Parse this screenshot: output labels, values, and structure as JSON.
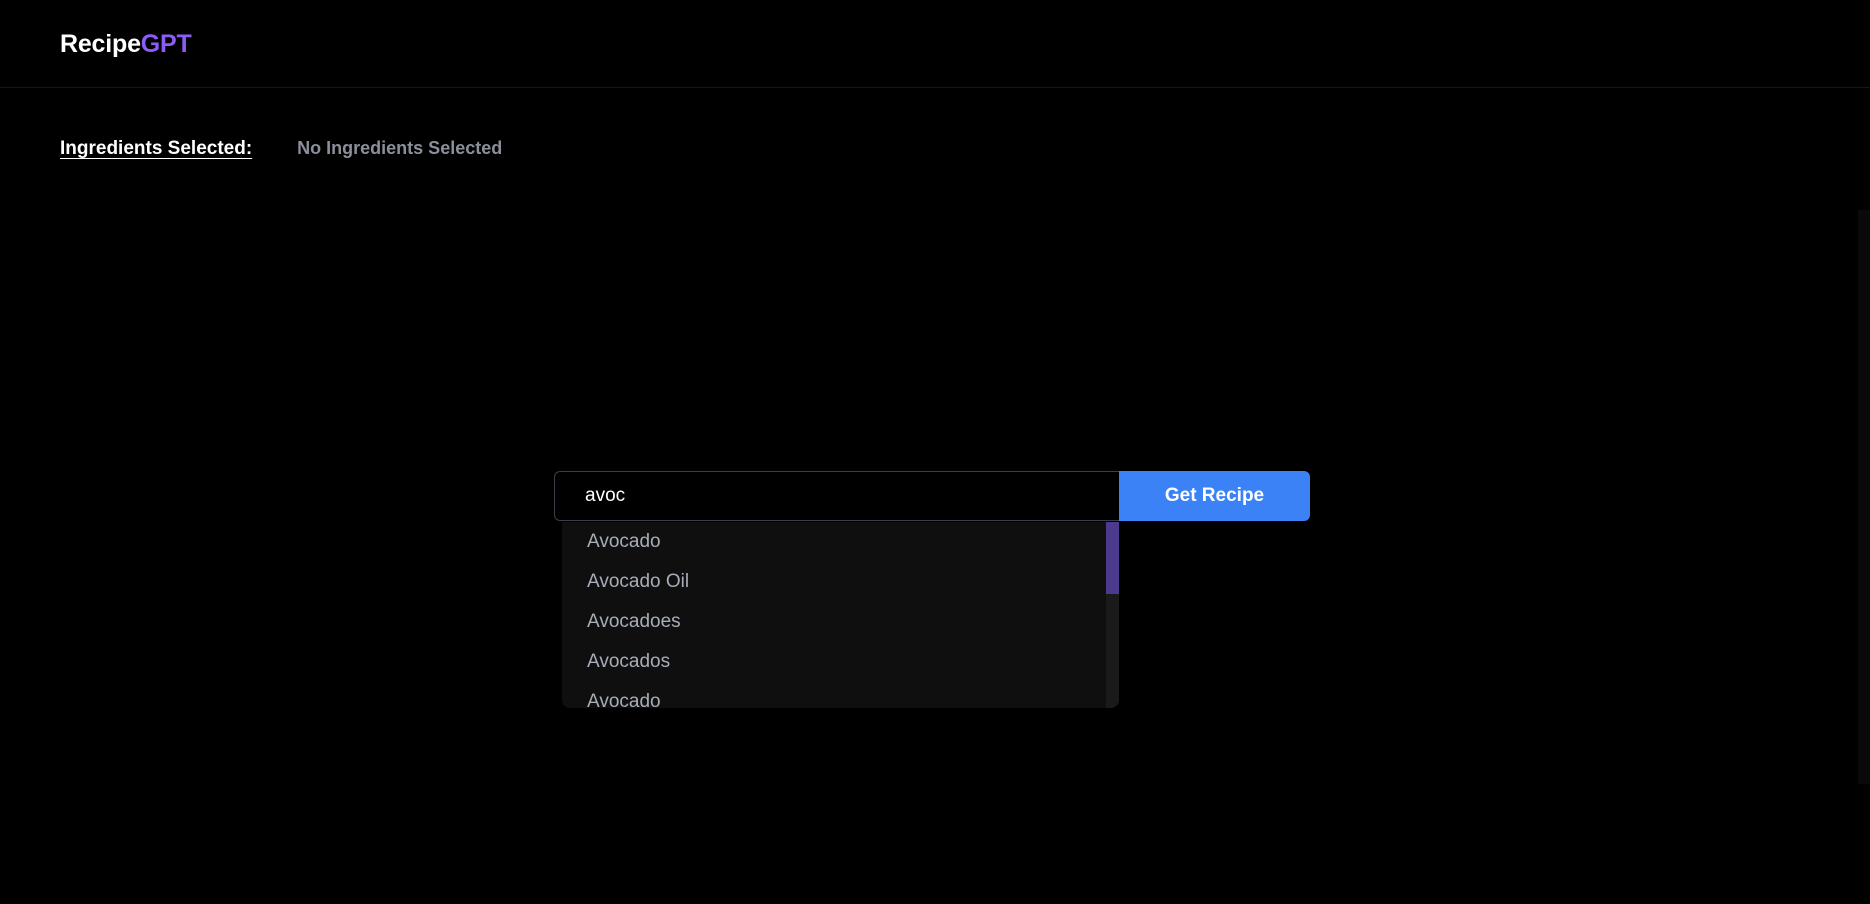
{
  "header": {
    "brand_primary": "Recipe",
    "brand_accent": "GPT",
    "accent_color": "#8b5cf6"
  },
  "selection": {
    "label": "Ingredients Selected:",
    "value": "No Ingredients Selected"
  },
  "search": {
    "value": "avoc",
    "button_label": "Get Recipe",
    "button_color": "#3b82f6"
  },
  "suggestions": [
    "Avocado",
    "Avocado Oil",
    "Avocadoes",
    "Avocados",
    "Avocado"
  ]
}
